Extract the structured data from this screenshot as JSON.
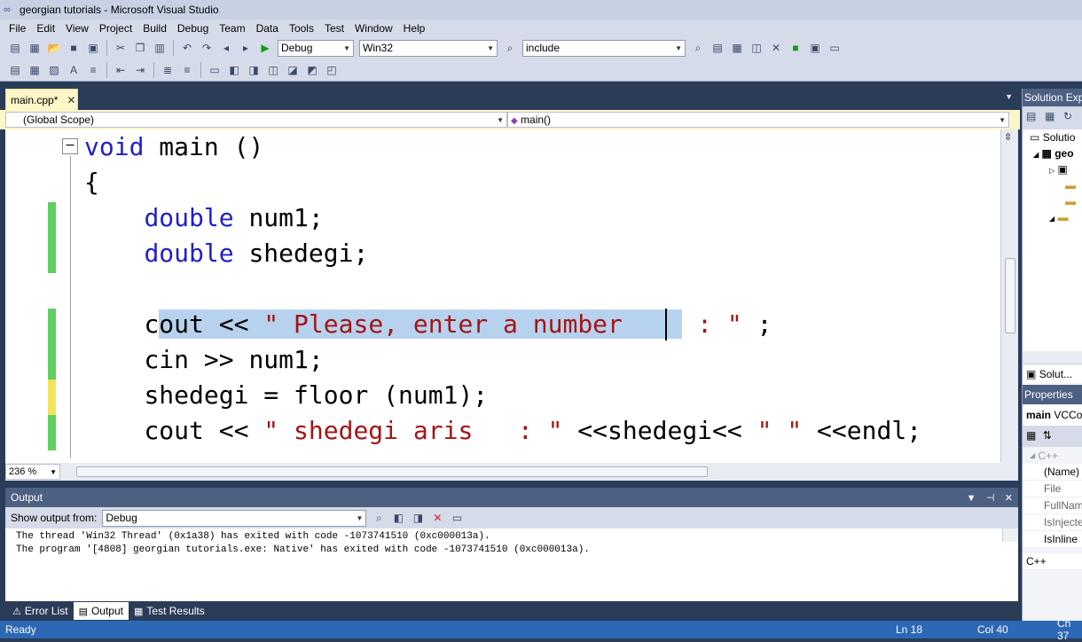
{
  "window": {
    "title": "georgian tutorials - Microsoft Visual Studio"
  },
  "menu": [
    "File",
    "Edit",
    "View",
    "Project",
    "Build",
    "Debug",
    "Team",
    "Data",
    "Tools",
    "Test",
    "Window",
    "Help"
  ],
  "toolbar": {
    "config": "Debug",
    "platform": "Win32",
    "find": "include"
  },
  "document": {
    "tab_label": "main.cpp*",
    "scope": "(Global Scope)",
    "member": "main()",
    "zoom": "236 %"
  },
  "code": {
    "l1_kw": "void",
    "l1_rest": " main ()",
    "l2": "{",
    "l3_kw": "double",
    "l3_rest": " num1;",
    "l4_kw": "double",
    "l4_rest": " shedegi;",
    "l5_pre": "cout << ",
    "l5_str_sel": "\" Please, enter a number    ",
    "l5_str_rest": " : \"",
    "l5_end": " ;",
    "l6": "cin >> num1;",
    "l7": "shedegi = floor (num1);",
    "l8_pre": "cout << ",
    "l8_str": "\" shedegi aris   : \"",
    "l8_mid": " <<shedegi<< ",
    "l8_str2": "\" \"",
    "l8_end": " <<endl;"
  },
  "output": {
    "title": "Output",
    "show_from_label": "Show output from:",
    "source": "Debug",
    "lines": [
      "The thread 'Win32 Thread' (0x1a38) has exited with code -1073741510 (0xc000013a).",
      "The program '[4808] georgian tutorials.exe: Native' has exited with code -1073741510 (0xc000013a)."
    ]
  },
  "bottom_tabs": [
    "Error List",
    "Output",
    "Test Results"
  ],
  "status": {
    "text": "Ready",
    "ln": "Ln 18",
    "col": "Col 40",
    "ch": "Ch 37"
  },
  "solution_explorer": {
    "title": "Solution Exp",
    "items": [
      "Solutio",
      "geo"
    ],
    "tab": "Solut..."
  },
  "properties": {
    "title": "Properties",
    "object_name": "main",
    "object_type": "VCCo",
    "category": "C++",
    "rows": [
      "(Name)",
      "File",
      "FullNam",
      "IsInjecte",
      "IsInline"
    ],
    "footer": "C++"
  },
  "colors": {
    "keyword": "#1f1fc7",
    "string": "#a31515",
    "selection": "#b7d2ee",
    "status_bar": "#2c68b5",
    "change_green": "#5fcf5f",
    "change_yellow": "#f2e55a"
  }
}
